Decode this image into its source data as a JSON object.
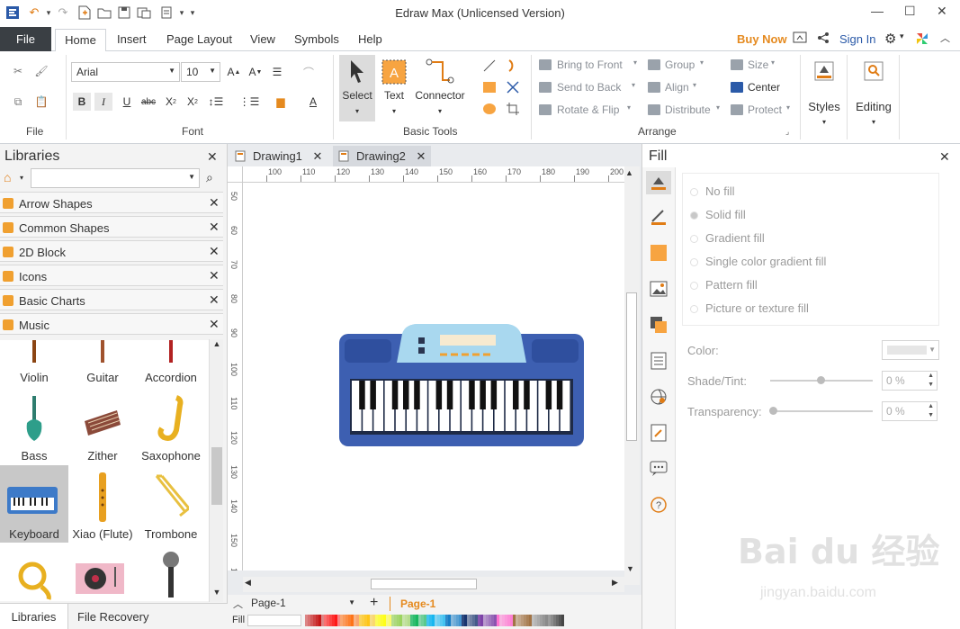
{
  "window": {
    "title": "Edraw Max (Unlicensed Version)"
  },
  "ribbon_tabs": {
    "file": "File",
    "home": "Home",
    "insert": "Insert",
    "page_layout": "Page Layout",
    "view": "View",
    "symbols": "Symbols",
    "help": "Help"
  },
  "account": {
    "buy_now": "Buy Now",
    "sign_in": "Sign In"
  },
  "font": {
    "family": "Arial",
    "size": "10"
  },
  "groups": {
    "file": "File",
    "font": "Font",
    "basic_tools": "Basic Tools",
    "arrange": "Arrange"
  },
  "tools": {
    "select": "Select",
    "text": "Text",
    "connector": "Connector",
    "styles": "Styles",
    "editing": "Editing"
  },
  "arrange": {
    "bring_to_front": "Bring to Front",
    "send_to_back": "Send to Back",
    "rotate_flip": "Rotate & Flip",
    "group": "Group",
    "align": "Align",
    "distribute": "Distribute",
    "size": "Size",
    "center": "Center",
    "protect": "Protect"
  },
  "libraries": {
    "title": "Libraries",
    "categories": [
      "Arrow Shapes",
      "Common Shapes",
      "2D Block",
      "Icons",
      "Basic Charts",
      "Music"
    ],
    "items": [
      "Violin",
      "Guitar",
      "Accordion",
      "Bass",
      "Zither",
      "Saxophone",
      "Keyboard",
      "Xiao (Flute)",
      "Trombone",
      "Horn",
      "Dish Player",
      "Micropho..."
    ],
    "bottom_tabs": [
      "Libraries",
      "File Recovery"
    ]
  },
  "documents": {
    "tabs": [
      "Drawing1",
      "Drawing2"
    ],
    "page_select": "Page-1",
    "page_tab": "Page-1",
    "fill_label": "Fill"
  },
  "rulers": {
    "h": [
      "100",
      "110",
      "120",
      "130",
      "140",
      "150",
      "160",
      "170",
      "180",
      "190",
      "200"
    ],
    "v": [
      "50",
      "60",
      "70",
      "80",
      "90",
      "100",
      "110",
      "120",
      "130",
      "140",
      "150",
      "160"
    ]
  },
  "fill": {
    "title": "Fill",
    "options": [
      "No fill",
      "Solid fill",
      "Gradient fill",
      "Single color gradient fill",
      "Pattern fill",
      "Picture or texture fill"
    ],
    "color_label": "Color:",
    "shade_label": "Shade/Tint:",
    "shade_value": "0 %",
    "transparency_label": "Transparency:",
    "transparency_value": "0 %"
  },
  "colors": {
    "accent_orange": "#e58a1f",
    "file_tab": "#3a3f44",
    "keyboard_body": "#3d5fb1",
    "keyboard_top": "#a9d8ef"
  }
}
